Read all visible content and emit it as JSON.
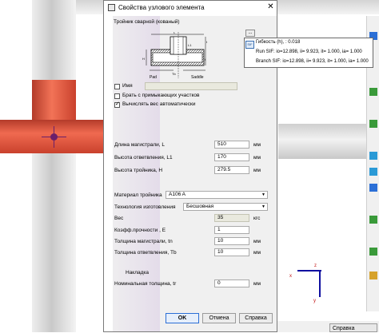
{
  "dialog": {
    "title": "Свойства узлового элемента",
    "close": "✕",
    "element_type": "Тройник сварной (кованый)",
    "browse_button": "...",
    "name_label": "Имя",
    "adjacent_label": "Брать с примыкающих участков",
    "auto_weight_label": "Вычислять вес автоматически",
    "diagram": {
      "L": "L",
      "tn": "t",
      "L1": "L1",
      "H": "H",
      "tr": "t",
      "Tb": "Tb",
      "pad": "Pad",
      "saddle": "Saddle"
    },
    "fields": {
      "length_main": {
        "label": "Длина магистрали, L",
        "value": "510",
        "unit": "мм"
      },
      "height_branch": {
        "label": "Высота ответвления, L1",
        "value": "170",
        "unit": "мм"
      },
      "height_tee": {
        "label": "Высота тройника, H",
        "value": "279.5",
        "unit": "мм"
      },
      "material": {
        "label": "Материал тройника",
        "value": "A106 A"
      },
      "tech": {
        "label": "Технология изготовления",
        "value": "Бесшовная"
      },
      "weight": {
        "label": "Вес",
        "value": "35",
        "unit": "кгс"
      },
      "strength": {
        "label": "Коэфф.прочности , E",
        "value": "1"
      },
      "thick_main": {
        "label": "Толщина магистрали, tn",
        "value": "10",
        "unit": "мм"
      },
      "thick_branch": {
        "label": "Толщина ответвления, Tb",
        "value": "10",
        "unit": "мм"
      },
      "pad_header": "Накладка",
      "pad_thickness": {
        "label": "Номинальная толщина, tr",
        "value": "0",
        "unit": "мм"
      }
    },
    "buttons": {
      "ok": "OK",
      "cancel": "Отмена",
      "help": "Справка"
    }
  },
  "tooltip": {
    "icon": "SIF",
    "line1": "Гибкость (h), : 0.018",
    "line2": "Run SIF: io=12.898, ii= 9.923, it= 1.000, ia= 1.000",
    "line3": "Branch SIF: io=12.898, ii= 9.923, it= 1.000, ia= 1.000"
  },
  "canvas": {
    "axis_z": "z",
    "axis_x": "x",
    "axis_y": "y",
    "status_help": "Справка"
  },
  "colors": {
    "tee": "#e8563e",
    "axis": "#1010a0",
    "accent": "#2b6fd6"
  }
}
